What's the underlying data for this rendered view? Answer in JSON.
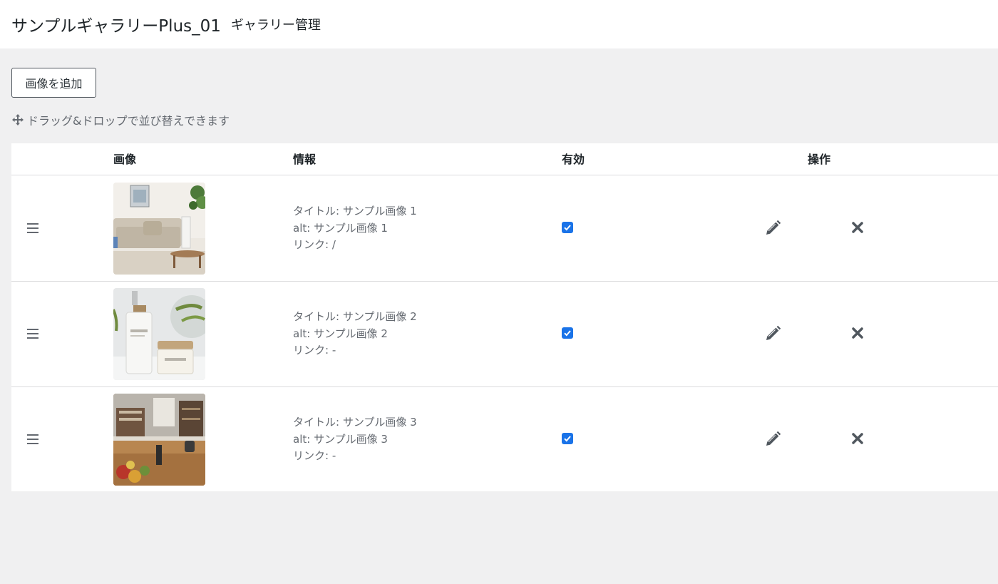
{
  "header": {
    "plugin_title": "サンプルギャラリーPlus_01",
    "page_subtitle": "ギャラリー管理"
  },
  "toolbar": {
    "add_label": "画像を追加",
    "drag_hint": "ドラッグ&ドロップで並び替えできます",
    "drag_icon": "move-arrows-icon"
  },
  "table": {
    "headers": {
      "image": "画像",
      "info": "情報",
      "enabled": "有効",
      "actions": "操作"
    },
    "rows": [
      {
        "title": "タイトル: サンプル画像 1",
        "alt": "alt: サンプル画像 1",
        "link": "リンク: /",
        "enabled": true,
        "thumbnail": "living-room-photo"
      },
      {
        "title": "タイトル: サンプル画像 2",
        "alt": "alt: サンプル画像 2",
        "link": "リンク: -",
        "enabled": true,
        "thumbnail": "cosmetics-photo"
      },
      {
        "title": "タイトル: サンプル画像 3",
        "alt": "alt: サンプル画像 3",
        "link": "リンク: -",
        "enabled": true,
        "thumbnail": "kitchen-photo"
      }
    ]
  },
  "colors": {
    "checkbox": "#1a73e8",
    "icon": "#50575e",
    "page_bg": "#f0f0f1"
  }
}
